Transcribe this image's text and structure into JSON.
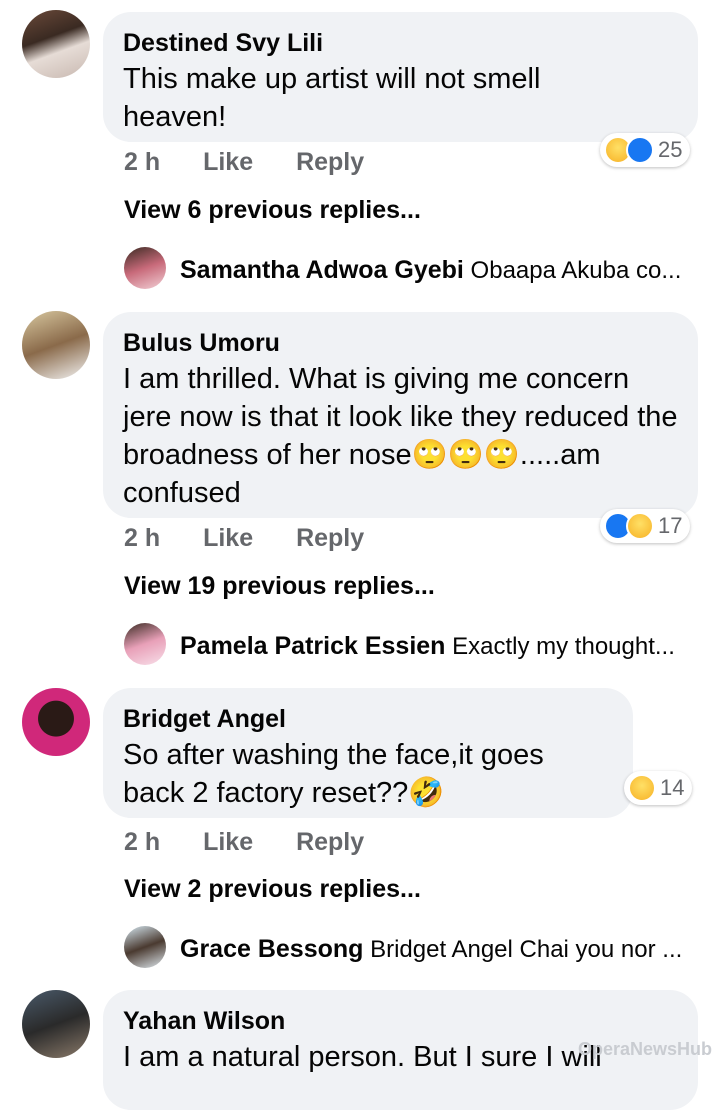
{
  "comments": [
    {
      "author": "Destined Svy Lili",
      "text": "This make up artist will not smell heaven!",
      "time": "2 h",
      "like": "Like",
      "reply": "Reply",
      "reaction_count": "25",
      "reactions": [
        "haha-icon",
        "like-icon"
      ],
      "view_replies": "View 6 previous replies...",
      "last_reply": {
        "name": "Samantha Adwoa Gyebi",
        "text": "Obaapa Akuba co..."
      }
    },
    {
      "author": "Bulus Umoru",
      "text": "I am thrilled. What is giving me concern jere now is that it look like they reduced the broadness of her nose🙄🙄🙄.....am confused",
      "time": "2 h",
      "like": "Like",
      "reply": "Reply",
      "reaction_count": "17",
      "reactions": [
        "like-icon",
        "haha-icon"
      ],
      "view_replies": "View 19 previous replies...",
      "last_reply": {
        "name": "Pamela Patrick Essien",
        "text": "Exactly my thought..."
      }
    },
    {
      "author": "Bridget Angel",
      "text": "So after washing the face,it goes back 2 factory reset??🤣",
      "time": "2 h",
      "like": "Like",
      "reply": "Reply",
      "reaction_count": "14",
      "reactions": [
        "haha-icon"
      ],
      "view_replies": "View 2 previous replies...",
      "last_reply": {
        "name": "Grace Bessong",
        "text": "Bridget Angel Chai you nor ..."
      }
    },
    {
      "author": "Yahan Wilson",
      "text": "I am a natural person. But I sure I will"
    }
  ],
  "watermark": "OperaNewsHub",
  "colors": {
    "bubble": "#f0f2f5",
    "muted": "#65676b",
    "like_blue": "#1877f2",
    "haha_yellow": "#f7b125"
  }
}
